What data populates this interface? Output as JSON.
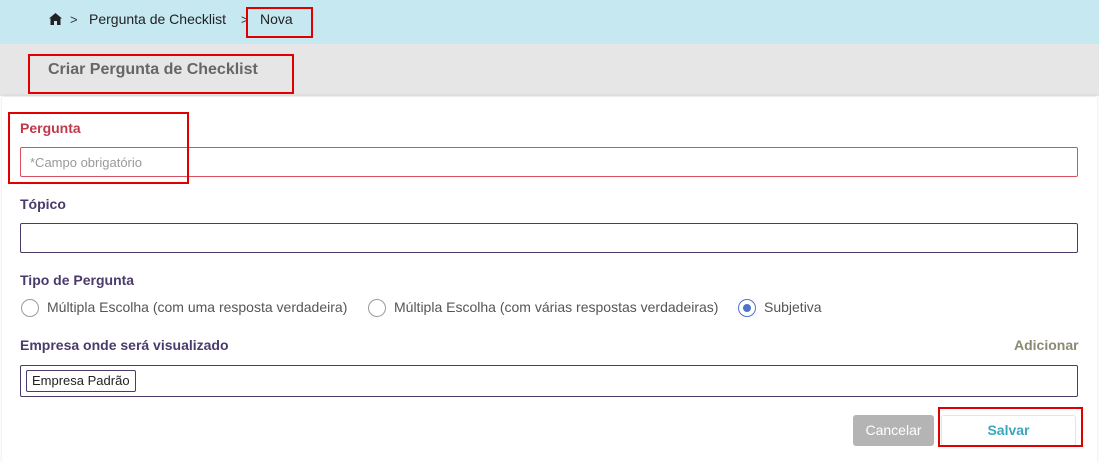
{
  "breadcrumb": {
    "home_icon": "home-icon",
    "separator": ">",
    "items": [
      "Pergunta de Checklist",
      "Nova"
    ]
  },
  "page": {
    "title": "Criar Pergunta de Checklist"
  },
  "form": {
    "question": {
      "label": "Pergunta",
      "value": "",
      "placeholder": "*Campo obrigatório"
    },
    "topic": {
      "label": "Tópico",
      "value": "",
      "placeholder": ""
    },
    "question_type": {
      "label": "Tipo de Pergunta",
      "options": [
        {
          "label": "Múltipla Escolha (com uma resposta verdadeira)",
          "selected": false
        },
        {
          "label": "Múltipla Escolha (com várias respostas verdadeiras)",
          "selected": false
        },
        {
          "label": "Subjetiva",
          "selected": true
        }
      ]
    },
    "company": {
      "label": "Empresa onde será visualizado",
      "add_label": "Adicionar",
      "tags": [
        "Empresa Padrão"
      ]
    }
  },
  "actions": {
    "cancel_label": "Cancelar",
    "save_label": "Salvar"
  },
  "colors": {
    "breadcrumb_bg": "#c5e8f1",
    "title_bar_bg": "#e6e6e6",
    "label_color": "#4a3b6b",
    "required_color": "#c0394b",
    "radio_accent": "#4e73c9",
    "save_text": "#3aa6bd",
    "highlight": "#e00000"
  }
}
